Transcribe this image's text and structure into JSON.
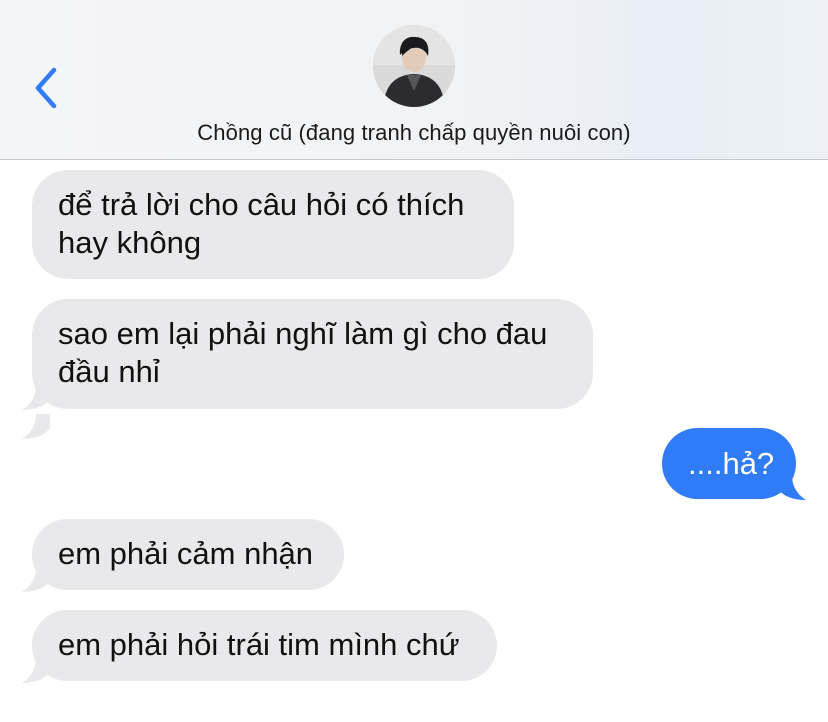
{
  "header": {
    "back_icon": "chevron-left-icon",
    "contact_name": "Chồng cũ (đang tranh chấp quyền nuôi con)",
    "avatar_icon": "contact-avatar",
    "accent_color": "#2f7cf6"
  },
  "messages": [
    {
      "direction": "incoming",
      "text": "để trả lời cho câu hỏi có thích hay không"
    },
    {
      "direction": "incoming",
      "text": "sao em lại phải nghĩ làm gì cho đau đầu nhỉ"
    },
    {
      "direction": "outgoing",
      "text": "....hả?"
    },
    {
      "direction": "incoming",
      "text": "em phải cảm nhận"
    },
    {
      "direction": "incoming",
      "text": "em phải hỏi trái tim mình chứ"
    }
  ],
  "colors": {
    "incoming_bubble": "#e9e9eb",
    "outgoing_bubble": "#2f7cf6",
    "header_background": "#f3f4f6"
  }
}
